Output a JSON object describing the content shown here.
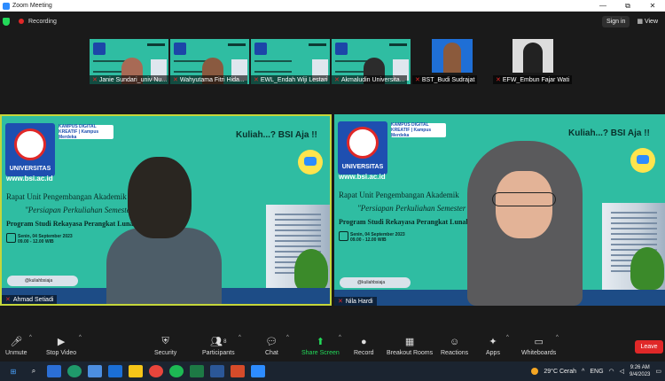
{
  "window": {
    "title": "Zoom Meeting",
    "controls": [
      "—",
      "⧉",
      "✕"
    ]
  },
  "topbar": {
    "recording": "Recording",
    "sign_in": "Sign in",
    "view": "View"
  },
  "thumbnails": [
    {
      "name": "Janie Sundari_univ Nu...",
      "kind": "slide"
    },
    {
      "name": "Wahyutama Fitri Hida...",
      "kind": "slide"
    },
    {
      "name": "EWL_Endah Wiji Lestari",
      "kind": "slide"
    },
    {
      "name": "Akmaludin Universita...",
      "kind": "slide-dark"
    },
    {
      "name": "BST_Budi Sudrajat",
      "kind": "photo-blue"
    },
    {
      "name": "EFW_Embun Fajar Wati",
      "kind": "photo-room"
    }
  ],
  "slide": {
    "university": "UNIVERSITAS",
    "url": "www.bsi.ac.id",
    "partners": "KAMPUS DIGITAL KREATIF | Kampus Merdeka",
    "slogan": "Kuliah...? BSI Aja !!",
    "badge": "zoom",
    "title_line1": "Rapat Unit Pengembangan Akademik",
    "title_line2": "\"Persiapan Perkuliahan Semester Gasal 2",
    "title_line3": "Program Studi Rekayasa Perangkat Lunak",
    "date_line1": "Senin, 04 September 2023",
    "date_line2": "09.00 - 12.00 WIB",
    "social": "@kuliahbsiaja"
  },
  "main_tiles": [
    {
      "name": "Ahmad Setiadi",
      "active": true
    },
    {
      "name": "Nila Hardi",
      "active": false
    }
  ],
  "toolbar": {
    "unmute": "Unmute",
    "stop_video": "Stop Video",
    "security": "Security",
    "participants": "Participants",
    "participants_count": "8",
    "chat": "Chat",
    "share_screen": "Share Screen",
    "record": "Record",
    "breakout_rooms": "Breakout Rooms",
    "reactions": "Reactions",
    "apps": "Apps",
    "whiteboards": "Whiteboards",
    "leave": "Leave"
  },
  "taskbar": {
    "weather": "29°C Cerah",
    "language": "ENG",
    "time": "9:26 AM",
    "date": "9/4/2023"
  },
  "colors": {
    "slide_bg": "#2fbda2",
    "active_border": "#c5d63a",
    "leave": "#e02828",
    "share_green": "#23d959"
  }
}
